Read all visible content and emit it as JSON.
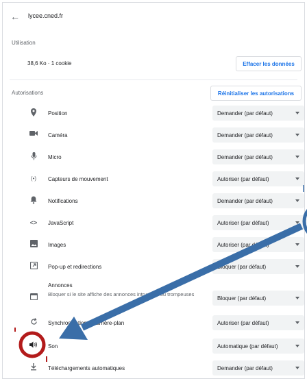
{
  "header": {
    "site": "lycee.cned.fr"
  },
  "usage": {
    "label": "Utilisation",
    "text": "38,6 Ko · 1 cookie",
    "clear_button": "Effacer les données"
  },
  "permissions": {
    "label": "Autorisations",
    "reset_button": "Réinitialiser les autorisations",
    "items": [
      {
        "label": "Position",
        "value": "Demander (par défaut)",
        "icon": "location-pin-icon"
      },
      {
        "label": "Caméra",
        "value": "Demander (par défaut)",
        "icon": "camera-icon"
      },
      {
        "label": "Micro",
        "value": "Demander (par défaut)",
        "icon": "microphone-icon"
      },
      {
        "label": "Capteurs de mouvement",
        "value": "Autoriser (par défaut)",
        "icon": "motion-sensor-icon"
      },
      {
        "label": "Notifications",
        "value": "Demander (par défaut)",
        "icon": "bell-icon"
      },
      {
        "label": "JavaScript",
        "value": "Autoriser (par défaut)",
        "icon": "code-icon"
      },
      {
        "label": "Images",
        "value": "Autoriser (par défaut)",
        "icon": "image-icon"
      },
      {
        "label": "Pop-up et redirections",
        "value": "Bloquer (par défaut)",
        "icon": "popup-icon"
      },
      {
        "label": "Annonces",
        "sublabel": "Bloquer si le site affiche des annonces intrusives ou trompeuses",
        "value": "Bloquer (par défaut)",
        "icon": "ads-icon"
      },
      {
        "label": "Synchronisation en arrière-plan",
        "value": "Autoriser (par défaut)",
        "icon": "sync-icon"
      },
      {
        "label": "Son",
        "value": "Automatique (par défaut)",
        "icon": "speaker-icon"
      },
      {
        "label": "Téléchargements automatiques",
        "value": "Demander (par défaut)",
        "icon": "download-icon"
      }
    ]
  },
  "annotation": {
    "arrow_color": "#3a6ea8",
    "circle_color": "#b31b1b"
  }
}
